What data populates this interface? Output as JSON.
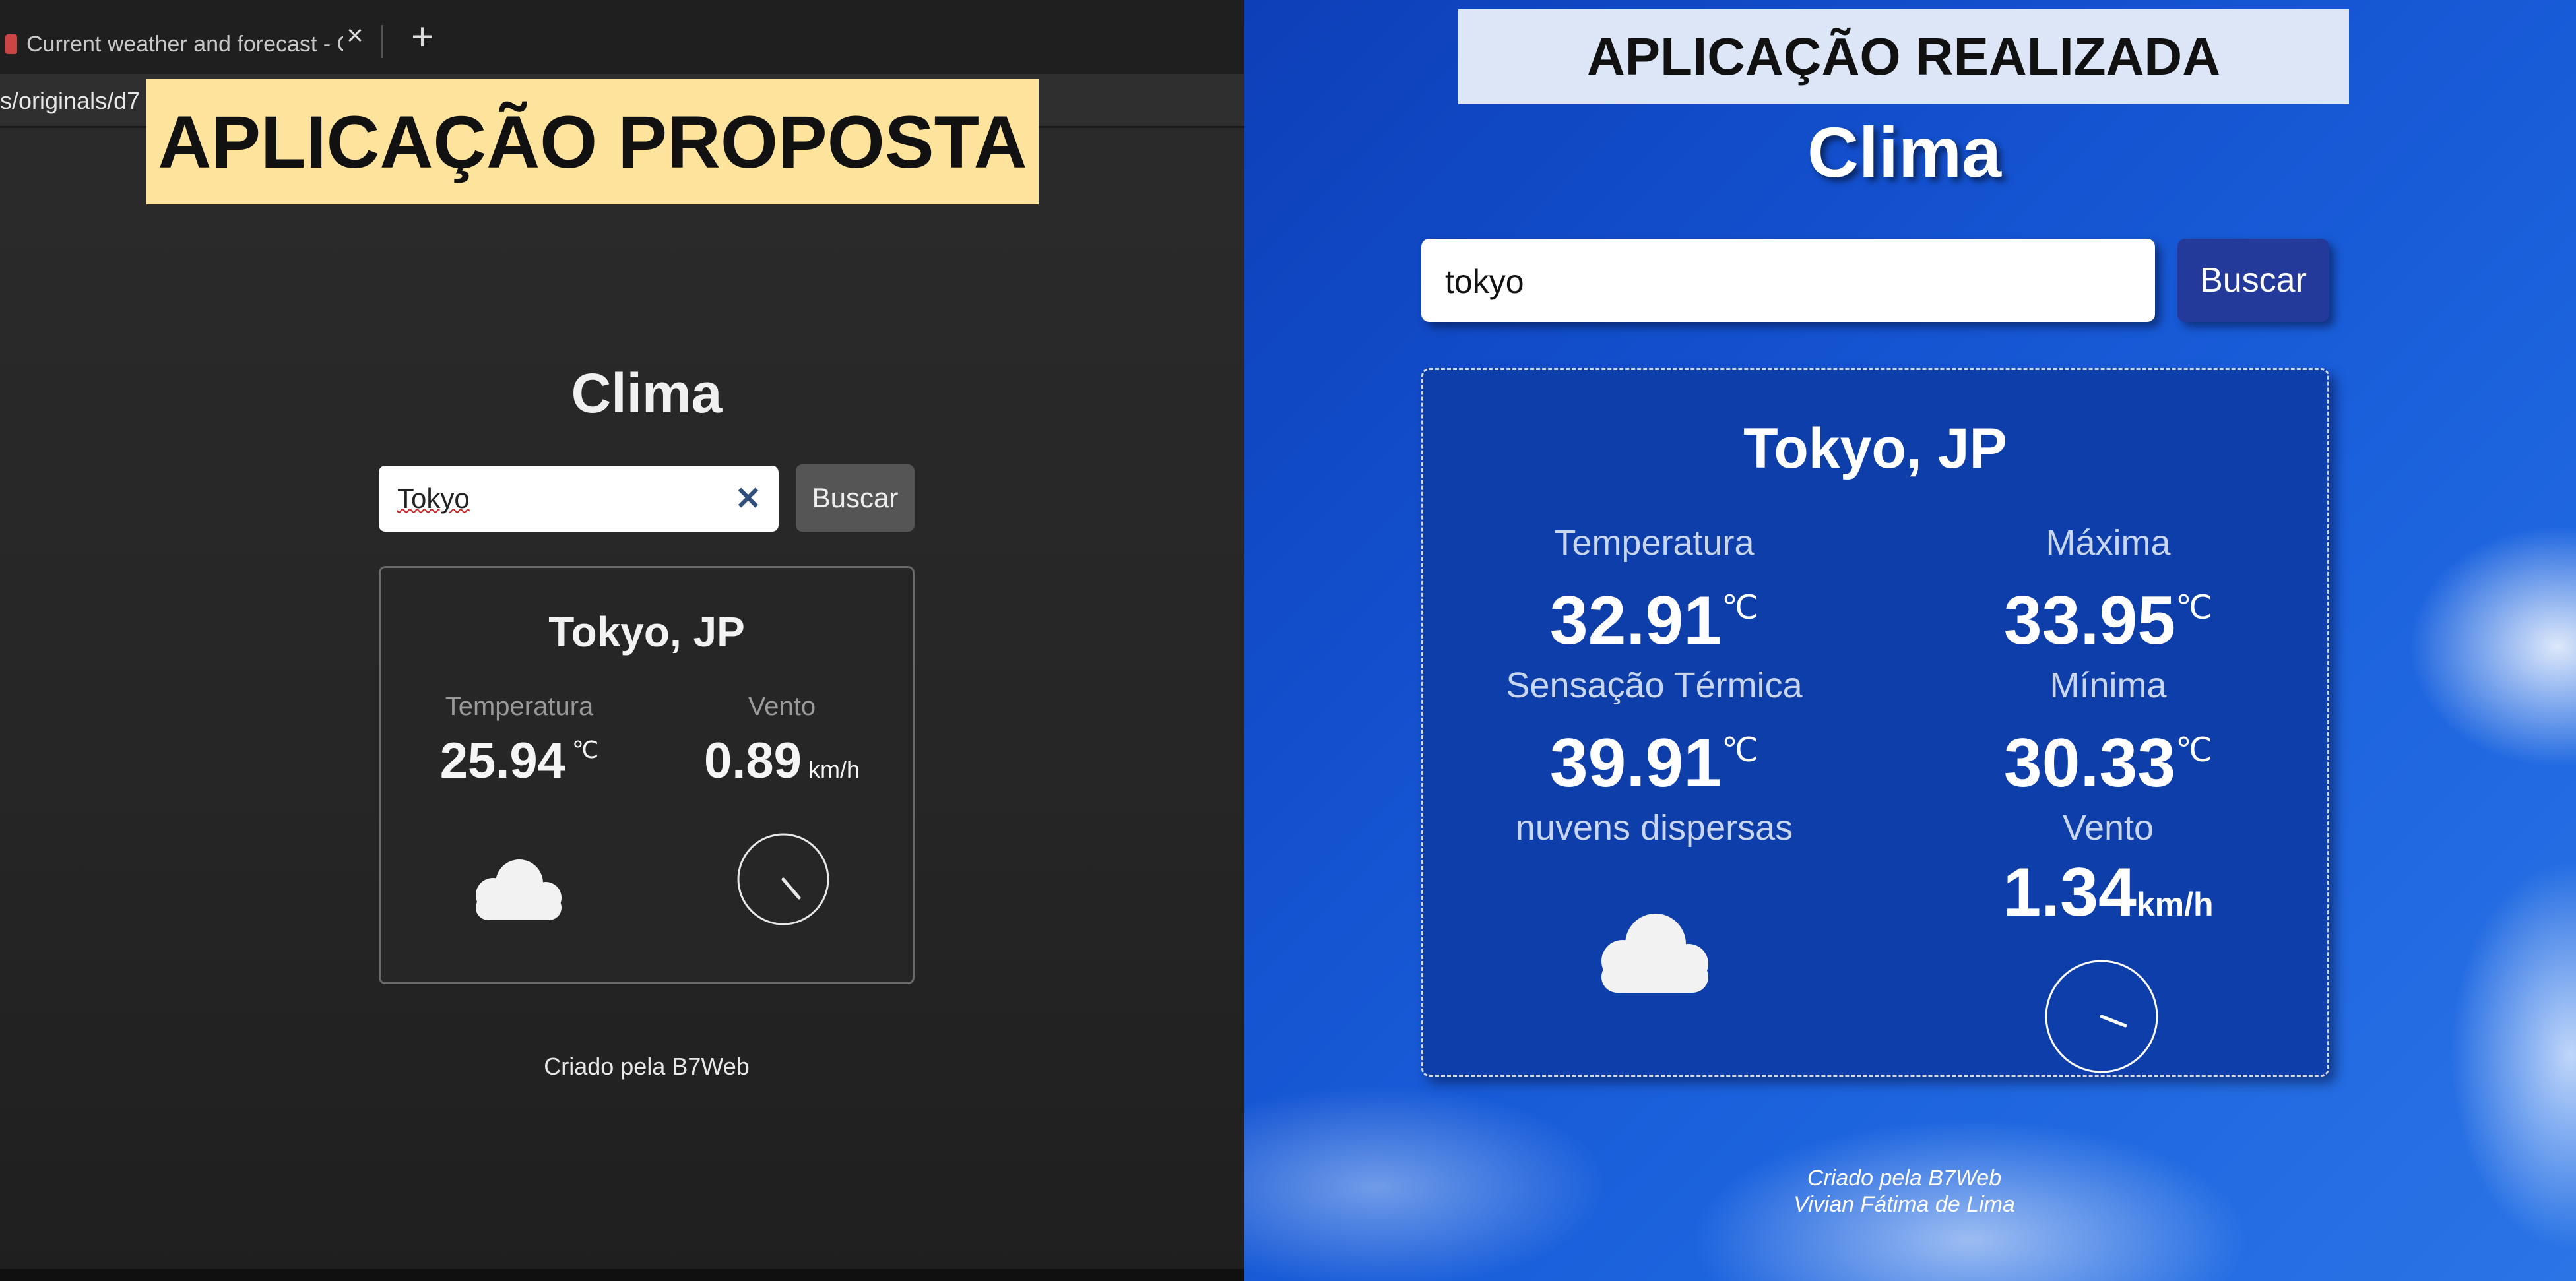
{
  "left_panel": {
    "label": "APLICAÇÃO PROPOSTA",
    "browser": {
      "tab_title": "Current weather and forecast - O",
      "url_fragment": "s/originals/d7"
    },
    "app": {
      "title": "Clima",
      "search_value": "Tokyo",
      "search_button": "Buscar",
      "city": "Tokyo, JP",
      "temperature_label": "Temperatura",
      "temperature_value": "25.94",
      "temperature_unit": "℃",
      "wind_label": "Vento",
      "wind_value": "0.89",
      "wind_unit": "km/h",
      "weather_icon": "cloud-icon",
      "footer": "Criado pela B7Web"
    }
  },
  "right_panel": {
    "label": "APLICAÇÃO REALIZADA",
    "app": {
      "title": "Clima",
      "search_value": "tokyo",
      "search_button": "Buscar",
      "city": "Tokyo, JP",
      "temperature_label": "Temperatura",
      "temperature_value": "32.91",
      "feels_like_label": "Sensação Térmica",
      "feels_like_value": "39.91",
      "description": "nuvens dispersas",
      "max_label": "Máxima",
      "max_value": "33.95",
      "min_label": "Mínima",
      "min_value": "30.33",
      "wind_label": "Vento",
      "wind_value": "1.34",
      "wind_unit": "km/h",
      "temp_unit": "℃",
      "weather_icon": "cloud-icon",
      "footer_line1": "Criado pela B7Web",
      "footer_line2": "Vivian Fátima de Lima"
    }
  }
}
